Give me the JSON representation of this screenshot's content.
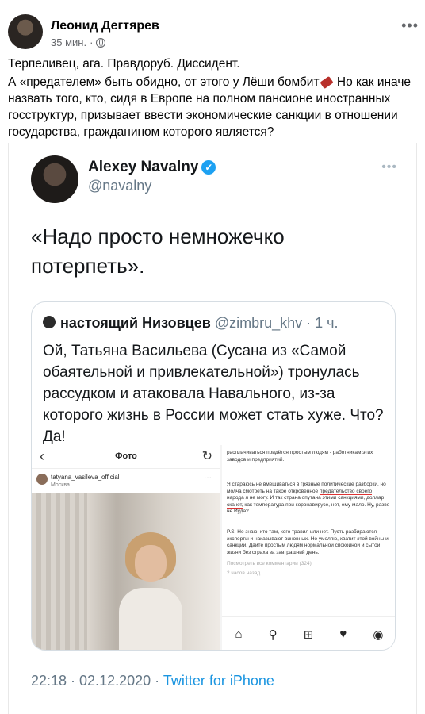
{
  "post": {
    "author": "Леонид Дегтярев",
    "time": "35 мин.",
    "separator": "·",
    "more_icon": "more-dots-icon",
    "paragraph1": "Терпеливец, ага. Правдоруб. Диссидент.",
    "paragraph2_a": "А «предателем» быть обидно, от этого у Лёши бомбит",
    "paragraph2_b": " Но как иначе назвать того, кто, сидя в Европе на полном пансионе иностранных госструктур, призывает ввести экономические санкции в отношении государства, гражданином которого является?"
  },
  "tweet": {
    "name": "Alexey Navalny",
    "verified_mark": "✓",
    "handle": "@navalny",
    "text": "«Надо просто немножечко потерпеть».",
    "footer_time": "22:18 · 02.12.2020 · ",
    "footer_source": "Twitter for iPhone",
    "quote": {
      "name": "настоящий Низовцев",
      "handle": " @zimbru_khv · 1 ч.",
      "text": "Ой, Татьяна Васильева (Сусана из «Самой обаятельной и привлекательной») тронулась рассудком и атаковала Навального, из-за которого жизнь в России может стать хуже. Что? Да!"
    }
  },
  "instagram": {
    "back": "‹",
    "title": "Фото",
    "refresh": "↻",
    "username": "tatyana_vasileva_official",
    "location": "Москва",
    "dots": "···",
    "comment1": "расплачиваться придётся простым людям - работникам этих заводов и предприятий.",
    "comment2_a": "Я стараюсь не вмешиваться в грязные политические разборки, но молча смотреть на такое откровенное ",
    "comment2_u": "предательство своего народа я не могу. И так страна опутана этими санкциями, доллар скачет,",
    "comment2_b": " как температура при коронавирусе, нет, ему мало. Ну, разве не Иуда?",
    "comment3": "P.S. Не знаю, кто там, кого травил или нет. Пусть разбираются эксперты и наказывают виновных. Но умоляю, хватит этой войны и санкций. Дайте простым людям нормальной спокойной и сытой жизни без страха за завтрашний день.",
    "view_comments": "Посмотреть все комментарии (324)",
    "ago": "2 часов назад",
    "nav": [
      "⌂",
      "⚲",
      "⊞",
      "♥",
      "◉"
    ]
  }
}
